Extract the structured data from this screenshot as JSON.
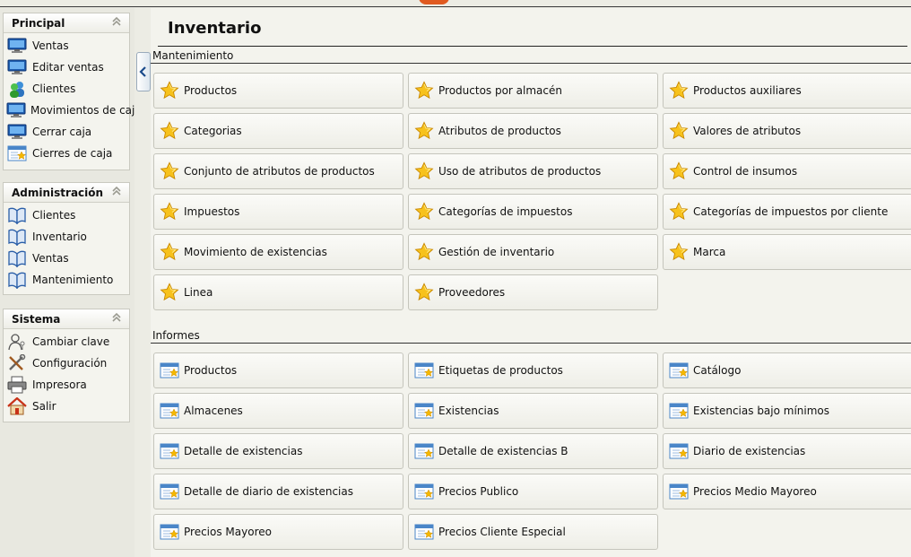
{
  "sidebar": {
    "principal": {
      "title": "Principal",
      "items": [
        {
          "label": "Ventas",
          "icon": "monitor-icon"
        },
        {
          "label": "Editar ventas",
          "icon": "monitor-icon"
        },
        {
          "label": "Clientes",
          "icon": "users-icon"
        },
        {
          "label": "Movimientos de caja",
          "icon": "monitor-icon"
        },
        {
          "label": "Cerrar caja",
          "icon": "monitor-icon"
        },
        {
          "label": "Cierres de caja",
          "icon": "report-icon"
        }
      ]
    },
    "administracion": {
      "title": "Administración",
      "items": [
        {
          "label": "Clientes",
          "icon": "book-icon"
        },
        {
          "label": "Inventario",
          "icon": "book-icon"
        },
        {
          "label": "Ventas",
          "icon": "book-icon"
        },
        {
          "label": "Mantenimiento",
          "icon": "book-icon"
        }
      ]
    },
    "sistema": {
      "title": "Sistema",
      "items": [
        {
          "label": "Cambiar clave",
          "icon": "user-key-icon"
        },
        {
          "label": "Configuración",
          "icon": "tools-icon"
        },
        {
          "label": "Impresora",
          "icon": "printer-icon"
        },
        {
          "label": "Salir",
          "icon": "home-icon"
        }
      ]
    }
  },
  "main": {
    "title": "Inventario",
    "mantenimiento": {
      "label": "Mantenimiento",
      "items": [
        "Productos",
        "Productos por almacén",
        "Productos auxiliares",
        "Categorias",
        "Atributos de productos",
        "Valores de atributos",
        "Conjunto de atributos de productos",
        "Uso de atributos de productos",
        "Control de insumos",
        "Impuestos",
        "Categorías de impuestos",
        "Categorías de impuestos por cliente",
        "Movimiento de existencias",
        "Gestión de inventario",
        "Marca",
        "Linea",
        "Proveedores"
      ]
    },
    "informes": {
      "label": "Informes",
      "items": [
        "Productos",
        "Etiquetas de productos",
        "Catálogo",
        "Almacenes",
        "Existencias",
        "Existencias bajo mínimos",
        "Detalle de existencias",
        "Detalle de existencias B",
        "Diario de existencias",
        "Detalle de diario de existencias",
        "Precios Publico",
        "Precios Medio Mayoreo",
        "Precios Mayoreo",
        "Precios Cliente Especial"
      ]
    }
  },
  "colors": {
    "accent": "#e05a20",
    "star": "#f5b800",
    "report_blue": "#4a86c8"
  }
}
